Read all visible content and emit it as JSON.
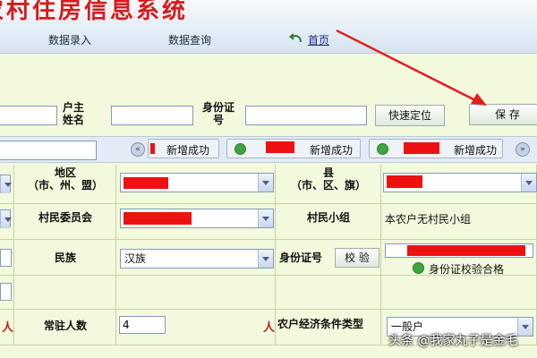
{
  "app": {
    "title": "农村住房信息系统"
  },
  "nav": {
    "data_entry": "数据录入",
    "data_query": "数据查询",
    "home": "首页"
  },
  "search": {
    "owner_label": "户主姓名",
    "id_label": "身份证号",
    "locate_button": "快速定位",
    "save_button": "保 存"
  },
  "record_tabs": [
    {
      "status": "新增成功"
    },
    {
      "status": "新增成功"
    },
    {
      "status": "新增成功"
    }
  ],
  "form": {
    "region_label": "地区\n（市、州、盟）",
    "county_label": "县\n（市、区、旗）",
    "village_committee_label": "村民委员会",
    "village_group_label": "村民小组",
    "village_group_value": "本农户无村民小组",
    "ethnicity_label": "民族",
    "ethnicity_value": "汉族",
    "id_label": "身份证号",
    "verify_button": "校 验",
    "id_verify_status": "身份证校验合格",
    "residents_label": "常驻人数",
    "residents_value": "4",
    "unit_person": "人",
    "economic_label": "农户经济条件类型",
    "economic_value": "一般户"
  },
  "watermark": "头条 @我家丸子是金毛",
  "colors": {
    "title_red": "#d51b1b",
    "form_bg": "#f3f9dc",
    "annotation_red": "#e02020"
  }
}
